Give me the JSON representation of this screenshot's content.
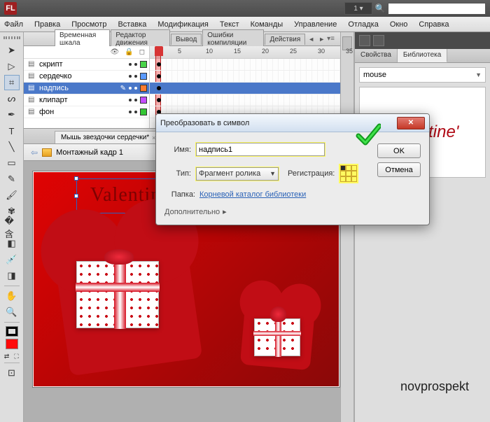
{
  "app": {
    "logo_text": "FL",
    "workspace": "1 ▾"
  },
  "menu": {
    "file": "Файл",
    "edit": "Правка",
    "view": "Просмотр",
    "insert": "Вставка",
    "modify": "Модификация",
    "text": "Текст",
    "commands": "Команды",
    "control": "Управление",
    "debug": "Отладка",
    "window": "Окно",
    "help": "Справка"
  },
  "timeline": {
    "tabs": {
      "timeline": "Временная шкала",
      "motion": "Редактор движения",
      "output": "Вывод",
      "errors": "Ошибки компиляции",
      "actions": "Действия"
    },
    "ruler": [
      "1",
      "5",
      "10",
      "15",
      "20",
      "25",
      "30",
      "35"
    ],
    "layers": [
      {
        "name": "скрипт"
      },
      {
        "name": "сердечко"
      },
      {
        "name": "надпись"
      },
      {
        "name": "клипарт"
      },
      {
        "name": "фон"
      }
    ]
  },
  "document": {
    "tab": "Мышь звездочки сердечки*",
    "scene": "Монтажный кадр 1"
  },
  "stage": {
    "text": "Valentine's Day"
  },
  "dialog": {
    "title": "Преобразовать в символ",
    "name_label": "Имя:",
    "name_value": "надпись1",
    "type_label": "Тип:",
    "type_value": "Фрагмент ролика",
    "reg_label": "Регистрация:",
    "folder_label": "Папка:",
    "folder_value": "Корневой каталог библиотеки",
    "more": "Дополнительно",
    "ok": "OK",
    "cancel": "Отмена"
  },
  "right": {
    "tab_props": "Свойства",
    "tab_lib": "Библиотека",
    "lib_name": "mouse",
    "preview_text": "Valentine'"
  },
  "watermark": "novprospekt"
}
